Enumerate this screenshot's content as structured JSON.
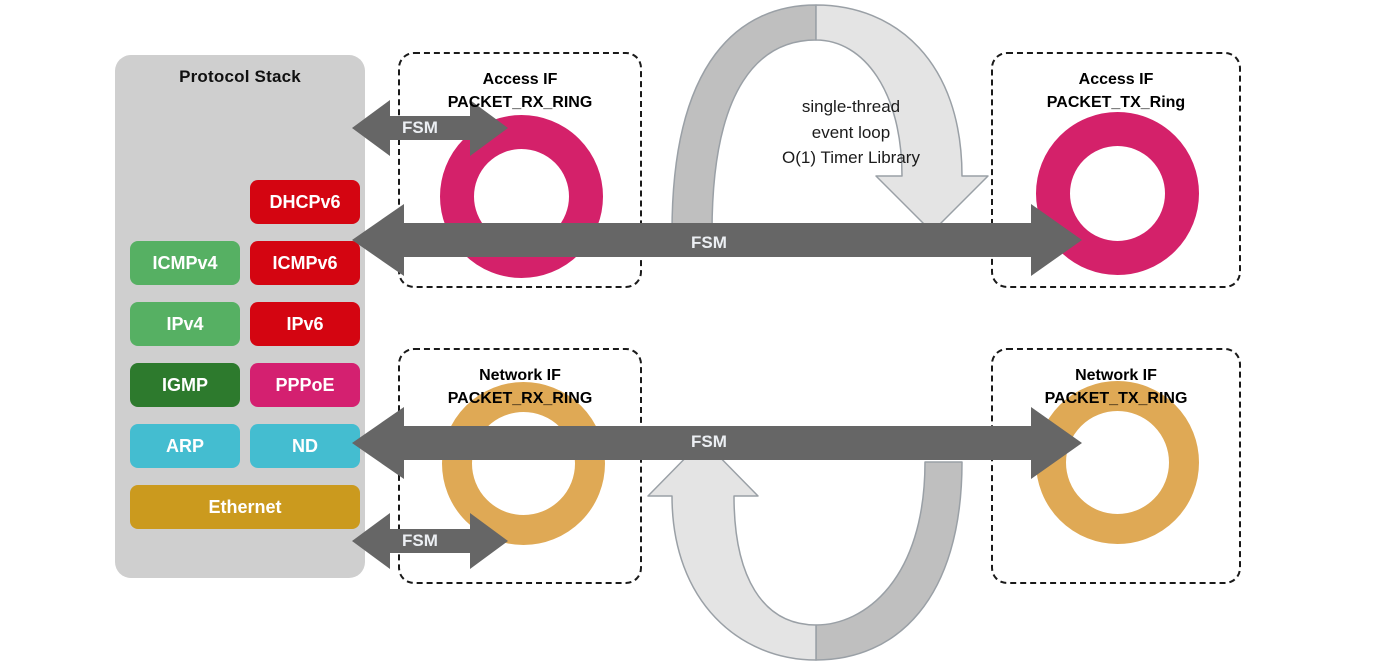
{
  "diagram": {
    "protocol_stack": {
      "title": "Protocol Stack",
      "panel_color": "#cfcfcf",
      "rows": [
        {
          "left": null,
          "right": {
            "label": "DHCPv6",
            "color": "#d40511"
          }
        },
        {
          "left": {
            "label": "ICMPv4",
            "color": "#56b063"
          },
          "right": {
            "label": "ICMPv6",
            "color": "#d40511"
          }
        },
        {
          "left": {
            "label": "IPv4",
            "color": "#56b063"
          },
          "right": {
            "label": "IPv6",
            "color": "#d40511"
          }
        },
        {
          "left": {
            "label": "IGMP",
            "color": "#2d7a2d"
          },
          "right": {
            "label": "PPPoE",
            "color": "#d42070"
          }
        },
        {
          "left": {
            "label": "ARP",
            "color": "#44bdd0"
          },
          "right": {
            "label": "ND",
            "color": "#44bdd0"
          }
        }
      ],
      "full_width_row": {
        "label": "Ethernet",
        "color": "#cb9a1e"
      }
    },
    "interfaces": [
      {
        "id": "access-rx",
        "title_line1": "Access IF",
        "title_line2": "PACKET_RX_RING",
        "ring_color": "#d4216a"
      },
      {
        "id": "access-tx",
        "title_line1": "Access IF",
        "title_line2": "PACKET_TX_Ring",
        "ring_color": "#d4216a"
      },
      {
        "id": "network-rx",
        "title_line1": "Network IF",
        "title_line2": "PACKET_RX_RING",
        "ring_color": "#dfa955"
      },
      {
        "id": "network-tx",
        "title_line1": "Network IF",
        "title_line2": "PACKET_TX_RING",
        "ring_color": "#dfa955"
      }
    ],
    "arrows": {
      "access_short_fsm": "FSM",
      "access_long_fsm": "FSM",
      "network_long_fsm": "FSM",
      "network_short_fsm": "FSM",
      "arrow_color": "#666666",
      "label_color": "#eceff3"
    },
    "event_loop": {
      "line1": "single-thread",
      "line2": "event loop",
      "line3": "O(1) Timer Library",
      "arc_dark_color": "#bfbfbf",
      "arc_light_color": "#e4e4e4",
      "arc_stroke_color": "#9aa0a6"
    }
  }
}
